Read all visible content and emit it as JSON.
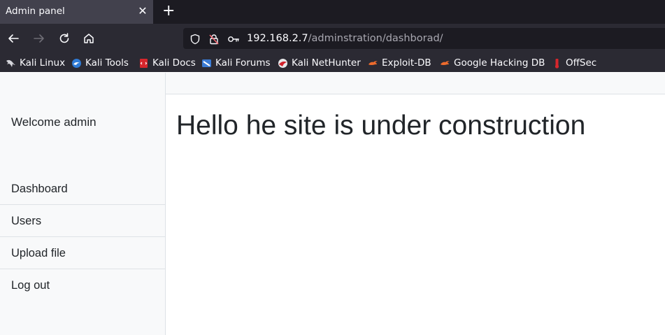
{
  "browser": {
    "tab": {
      "title": "Admin panel",
      "close_icon": "close-icon"
    },
    "new_tab_icon": "plus-icon",
    "nav": {
      "back_icon": "back-arrow-icon",
      "forward_icon": "forward-arrow-icon",
      "reload_icon": "reload-icon",
      "home_icon": "home-icon"
    },
    "url": {
      "host": "192.168.2.7",
      "path": "/adminstration/dashborad/",
      "shield_icon": "tracking-shield-icon",
      "insecure_icon": "insecure-lock-icon",
      "permissions_icon": "key-icon"
    },
    "bookmarks": [
      {
        "label": "Kali Linux",
        "icon": "kali-dragon-icon"
      },
      {
        "label": "Kali Tools",
        "icon": "kali-tools-icon"
      },
      {
        "label": "Kali Docs",
        "icon": "kali-docs-icon"
      },
      {
        "label": "Kali Forums",
        "icon": "kali-forums-icon"
      },
      {
        "label": "Kali NetHunter",
        "icon": "nethunter-icon"
      },
      {
        "label": "Exploit-DB",
        "icon": "exploit-db-icon"
      },
      {
        "label": "Google Hacking DB",
        "icon": "ghdb-icon"
      },
      {
        "label": "OffSec",
        "icon": "offsec-icon"
      }
    ]
  },
  "sidebar": {
    "heading": "Welcome admin",
    "items": [
      {
        "label": "Dashboard"
      },
      {
        "label": "Users"
      },
      {
        "label": "Upload file"
      },
      {
        "label": "Log out"
      }
    ]
  },
  "main": {
    "title": "Hello he site is under construction"
  },
  "colors": {
    "chrome_dark": "#1c1b22",
    "chrome_toolbar": "#2b2a33",
    "sidebar_bg": "#f8f9fa",
    "border": "#dee2e6",
    "text": "#212529"
  }
}
